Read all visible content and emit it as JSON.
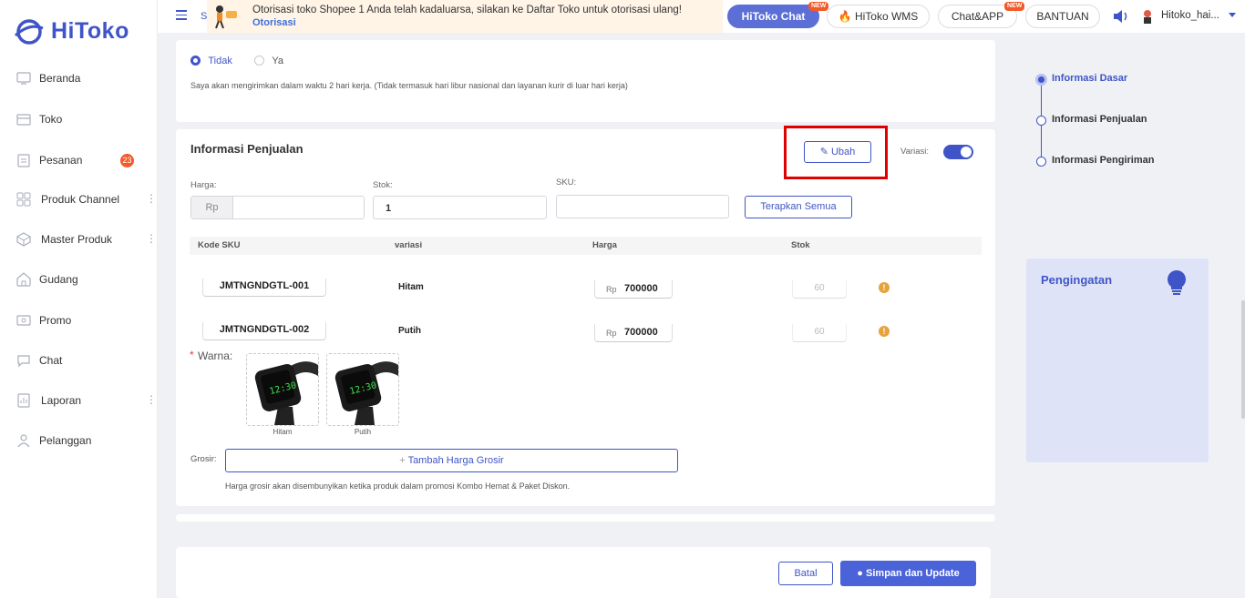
{
  "app": {
    "logo_text": "HiToko",
    "brand_color": "#3f55c7"
  },
  "sidebar": {
    "items": [
      {
        "label": "Beranda",
        "icon": "monitor-icon"
      },
      {
        "label": "Toko",
        "icon": "store-icon"
      },
      {
        "label": "Pesanan",
        "icon": "clipboard-icon",
        "badge": "23"
      },
      {
        "label": "Produk Channel",
        "icon": "grid-icon",
        "more": "⋮"
      },
      {
        "label": "Master Produk",
        "icon": "cube-icon",
        "more": "⋮"
      },
      {
        "label": "Gudang",
        "icon": "warehouse-icon"
      },
      {
        "label": "Promo",
        "icon": "promo-icon"
      },
      {
        "label": "Chat",
        "icon": "chat-icon"
      },
      {
        "label": "Laporan",
        "icon": "report-icon",
        "more": "⋮"
      },
      {
        "label": "Pelanggan",
        "icon": "users-icon"
      }
    ]
  },
  "topbar": {
    "s_letter": "S",
    "notice_text": "Otorisasi toko Shopee 1 Anda telah kadaluarsa, silakan ke Daftar Toko untuk otorisasi ulang!",
    "notice_link": "Otorisasi",
    "notice_close": "✕",
    "hitoko_chat": "HiToko Chat",
    "hitoko_wms": "HiToko WMS",
    "chat_app": "Chat&APP",
    "bantuan": "BANTUAN",
    "new_tag": "NEW",
    "user_name": "Hitoko_hai..."
  },
  "shipping": {
    "option_no": "Tidak",
    "option_yes": "Ya",
    "description": "Saya akan mengirimkan dalam waktu 2 hari kerja. (Tidak termasuk hari libur nasional dan layanan kurir di luar hari kerja)"
  },
  "sales": {
    "title": "Informasi Penjualan",
    "edit_button": "Ubah",
    "variation_label": "Variasi:",
    "variation_enabled": true,
    "price_label": "Harga:",
    "price_prefix": "Rp",
    "price_value": "",
    "stock_label": "Stok:",
    "stock_value": "1",
    "sku_label": "SKU:",
    "sku_value": "",
    "apply_all_button": "Terapkan Semua",
    "columns": [
      "Kode SKU",
      "variasi",
      "Harga",
      "Stok"
    ],
    "rows": [
      {
        "sku": "JMTNGNDGTL-001",
        "variant": "Hitam",
        "currency": "Rp",
        "price": "700000",
        "stock": "60",
        "warn": "!"
      },
      {
        "sku": "JMTNGNDGTL-002",
        "variant": "Putih",
        "currency": "Rp",
        "price": "700000",
        "stock": "60",
        "warn": "!"
      }
    ],
    "color_required_mark": "*",
    "color_label": "Warna:",
    "color_images": [
      {
        "caption": "Hitam",
        "watch_time": "12:30"
      },
      {
        "caption": "Putih",
        "watch_time": "12:30"
      }
    ],
    "wholesale_label": "Grosir:",
    "add_wholesale_button": "Tambah Harga Grosir",
    "wholesale_note": "Harga grosir akan disembunyikan ketika produk dalam promosi Kombo Hemat & Paket Diskon."
  },
  "footer": {
    "cancel_button": "Batal",
    "save_button": "Simpan dan Update"
  },
  "steps": [
    {
      "label": "Informasi Dasar",
      "active": true
    },
    {
      "label": "Informasi Penjualan",
      "active": false
    },
    {
      "label": "Informasi Pengiriman",
      "active": false
    }
  ],
  "reminder": {
    "title": "Pengingatan",
    "icon": "lightbulb-icon"
  }
}
